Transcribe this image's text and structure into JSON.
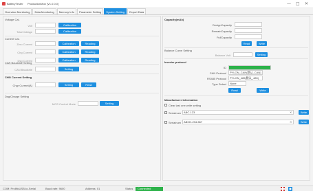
{
  "window": {
    "title": "BatteryTester",
    "subtitle": "ProductionMon [V1.0.0.0]",
    "minimize": "—",
    "maximize": "□",
    "close": "✕"
  },
  "tabs": [
    {
      "label": "Overview Monitoring"
    },
    {
      "label": "Data Monitoring"
    },
    {
      "label": "Memory Info"
    },
    {
      "label": "Parameter Setting"
    },
    {
      "label": "System Setting"
    },
    {
      "label": "Export Data"
    }
  ],
  "left": {
    "section1": {
      "title": "Voltage Cal.",
      "rows": [
        {
          "label": "Volt",
          "button": "Calibration"
        },
        {
          "label": "Total Voltage",
          "button": "Calibration"
        }
      ]
    },
    "section2": {
      "title": "Current Cal.",
      "rows": [
        {
          "label": "Zero Current",
          "button1": "Calibration",
          "button2": "Reading"
        },
        {
          "label": "Chg Current",
          "button1": "Calibration",
          "button2": "Reading"
        },
        {
          "label": "Dsg Current",
          "button1": "Calibration",
          "button2": "Reading"
        }
      ]
    },
    "section3": {
      "title": "CAN Baudrate Setting",
      "label": "CAN Baudrate",
      "button": "Setting"
    },
    "section4": {
      "title": "CHG Current Setting",
      "label": "Chgr Current(A)",
      "button1": "Setting",
      "button2": "Read"
    },
    "section5": {
      "title": "Dsg/Charge Setting",
      "label": "MOS Control Mode",
      "button": "Setting"
    }
  },
  "right": {
    "capacity": {
      "title": "Capacity(mAh)",
      "rows": [
        {
          "label": "DesignCapacity",
          "value": ""
        },
        {
          "label": "RemainCapacity",
          "value": ""
        },
        {
          "label": "FullCapacity",
          "value": ""
        }
      ],
      "read": "Read",
      "write": "Write"
    },
    "balance": {
      "title": "Balance Curve Setting",
      "label": "Balance Volt",
      "button": "Setting"
    },
    "inverter": {
      "title": "Inverter protocol",
      "id_label": "ID",
      "id_progress": 1.0,
      "rows": [
        {
          "label": "CAN Protocol",
          "value": "PYLON_CAN(默认_CAN)"
        },
        {
          "label": "RS485 Protocol",
          "value": "PYLON_485(默认_485)"
        },
        {
          "label": "Type Select",
          "value": "None"
        }
      ],
      "read": "Read",
      "write": "Write"
    },
    "manufacturer": {
      "title": "Manufacturer Information",
      "checkbox_label": "Clear last one write setting",
      "rows": [
        {
          "label": "Serialnum",
          "value": "ABC-123",
          "button": "Write"
        },
        {
          "label": "Serialnum",
          "value": "ABCD-234-567",
          "button": "Write"
        }
      ]
    }
  },
  "statusbar": {
    "port": "COM: ProlificUSB-to-Serial",
    "baud": "Baud rate: 9600",
    "addr": "Address: 01",
    "status_label": "Status",
    "status_value": "Connected"
  },
  "colors": {
    "accent": "#1e8fe0",
    "ok": "#2db24a"
  }
}
